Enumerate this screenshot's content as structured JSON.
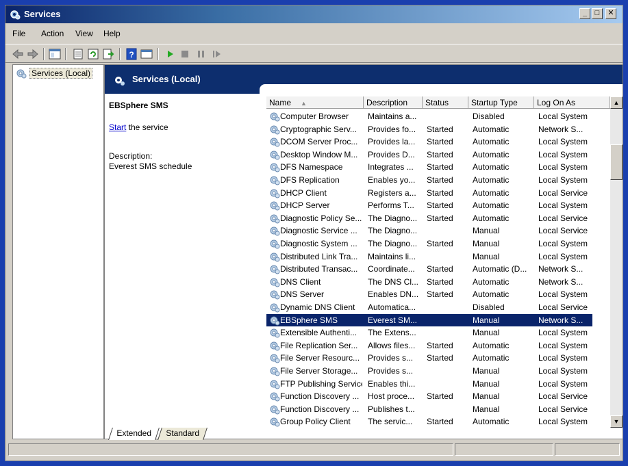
{
  "window": {
    "title": "Services"
  },
  "menu": [
    "File",
    "Action",
    "View",
    "Help"
  ],
  "tree": {
    "root_label": "Services (Local)"
  },
  "banner": {
    "title": "Services (Local)"
  },
  "detail": {
    "service_name": "EBSphere SMS",
    "start_link": "Start",
    "start_suffix": " the service",
    "description_label": "Description:",
    "description_text": "Everest SMS schedule"
  },
  "columns": [
    "Name",
    "Description",
    "Status",
    "Startup Type",
    "Log On As"
  ],
  "rows": [
    {
      "name": "Computer Browser",
      "desc": "Maintains a...",
      "status": "",
      "startup": "Disabled",
      "logon": "Local System"
    },
    {
      "name": "Cryptographic Serv...",
      "desc": "Provides fo...",
      "status": "Started",
      "startup": "Automatic",
      "logon": "Network S..."
    },
    {
      "name": "DCOM Server Proc...",
      "desc": "Provides la...",
      "status": "Started",
      "startup": "Automatic",
      "logon": "Local System"
    },
    {
      "name": "Desktop Window M...",
      "desc": "Provides D...",
      "status": "Started",
      "startup": "Automatic",
      "logon": "Local System"
    },
    {
      "name": "DFS Namespace",
      "desc": "Integrates ...",
      "status": "Started",
      "startup": "Automatic",
      "logon": "Local System"
    },
    {
      "name": "DFS Replication",
      "desc": "Enables yo...",
      "status": "Started",
      "startup": "Automatic",
      "logon": "Local System"
    },
    {
      "name": "DHCP Client",
      "desc": "Registers a...",
      "status": "Started",
      "startup": "Automatic",
      "logon": "Local Service"
    },
    {
      "name": "DHCP Server",
      "desc": "Performs T...",
      "status": "Started",
      "startup": "Automatic",
      "logon": "Local System"
    },
    {
      "name": "Diagnostic Policy Se...",
      "desc": "The Diagno...",
      "status": "Started",
      "startup": "Automatic",
      "logon": "Local Service"
    },
    {
      "name": "Diagnostic Service ...",
      "desc": "The Diagno...",
      "status": "",
      "startup": "Manual",
      "logon": "Local Service"
    },
    {
      "name": "Diagnostic System ...",
      "desc": "The Diagno...",
      "status": "Started",
      "startup": "Manual",
      "logon": "Local System"
    },
    {
      "name": "Distributed Link Tra...",
      "desc": "Maintains li...",
      "status": "",
      "startup": "Manual",
      "logon": "Local System"
    },
    {
      "name": "Distributed Transac...",
      "desc": "Coordinate...",
      "status": "Started",
      "startup": "Automatic (D...",
      "logon": "Network S..."
    },
    {
      "name": "DNS Client",
      "desc": "The DNS Cl...",
      "status": "Started",
      "startup": "Automatic",
      "logon": "Network S..."
    },
    {
      "name": "DNS Server",
      "desc": "Enables DN...",
      "status": "Started",
      "startup": "Automatic",
      "logon": "Local System"
    },
    {
      "name": "Dynamic DNS Client",
      "desc": "Automatica...",
      "status": "",
      "startup": "Disabled",
      "logon": "Local Service"
    },
    {
      "name": "EBSphere SMS",
      "desc": "Everest SM...",
      "status": "",
      "startup": "Manual",
      "logon": "Network S...",
      "selected": true
    },
    {
      "name": "Extensible Authenti...",
      "desc": "The Extens...",
      "status": "",
      "startup": "Manual",
      "logon": "Local System"
    },
    {
      "name": "File Replication Ser...",
      "desc": "Allows files...",
      "status": "Started",
      "startup": "Automatic",
      "logon": "Local System"
    },
    {
      "name": "File Server Resourc...",
      "desc": "Provides s...",
      "status": "Started",
      "startup": "Automatic",
      "logon": "Local System"
    },
    {
      "name": "File Server Storage...",
      "desc": "Provides s...",
      "status": "",
      "startup": "Manual",
      "logon": "Local System"
    },
    {
      "name": "FTP Publishing Service",
      "desc": "Enables thi...",
      "status": "",
      "startup": "Manual",
      "logon": "Local System"
    },
    {
      "name": "Function Discovery ...",
      "desc": "Host proce...",
      "status": "Started",
      "startup": "Manual",
      "logon": "Local Service"
    },
    {
      "name": "Function Discovery ...",
      "desc": "Publishes t...",
      "status": "",
      "startup": "Manual",
      "logon": "Local Service"
    },
    {
      "name": "Group Policy Client",
      "desc": "The servic...",
      "status": "Started",
      "startup": "Automatic",
      "logon": "Local System"
    }
  ],
  "tabs": [
    "Extended",
    "Standard"
  ],
  "colors": {
    "selection": "#0a246a",
    "banner": "#0d2e6e",
    "frame": "#1a3fae"
  }
}
